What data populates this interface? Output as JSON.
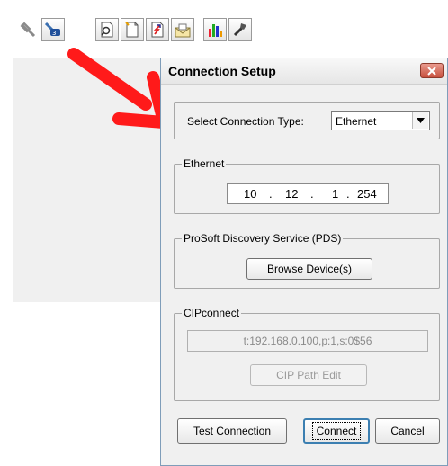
{
  "toolbar": {
    "buttons": [
      {
        "icon": "connect-plug-icon",
        "state": "disabled"
      },
      {
        "icon": "ethernet-config-icon",
        "state": "enabled"
      },
      {
        "icon": "search-document-icon",
        "state": "enabled"
      },
      {
        "icon": "new-document-icon",
        "state": "enabled"
      },
      {
        "icon": "upload-document-icon",
        "state": "enabled"
      },
      {
        "icon": "envelope-icon",
        "state": "enabled"
      },
      {
        "icon": "bar-chart-icon",
        "state": "enabled"
      },
      {
        "icon": "tools-icon",
        "state": "enabled"
      }
    ]
  },
  "annotation": {
    "color": "#ff1a1a"
  },
  "dialog": {
    "title": "Connection Setup",
    "connection_type": {
      "label": "Select Connection Type:",
      "value": "Ethernet"
    },
    "ethernet": {
      "legend": "Ethernet",
      "ip": [
        "10",
        "12",
        "1",
        "254"
      ],
      "separator": "."
    },
    "pds": {
      "legend": "ProSoft Discovery Service (PDS)",
      "browse_label": "Browse Device(s)"
    },
    "cip": {
      "legend": "CIPconnect",
      "path_value": "t:192.168.0.100,p:1,s:0$56",
      "edit_label": "CIP Path Edit"
    },
    "buttons": {
      "test": "Test Connection",
      "connect": "Connect",
      "cancel": "Cancel"
    }
  }
}
